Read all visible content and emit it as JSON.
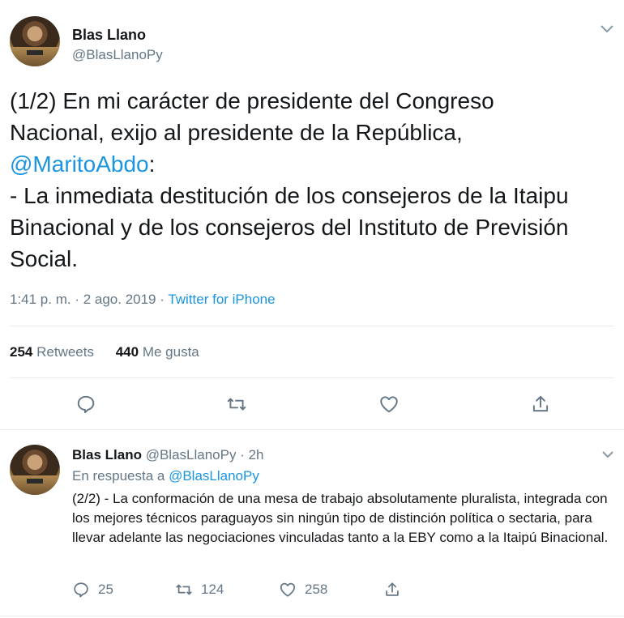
{
  "main_tweet": {
    "author_name": "Blas Llano",
    "author_handle": "@BlasLlanoPy",
    "text_before_mention": "(1/2) En mi carácter de presidente del Congreso\nNacional, exijo al presidente de la República,\n",
    "mention": "@MaritoAbdo",
    "text_after_mention": ":\n- La inmediata destitución de los consejeros de la Itaipu\nBinacional y de los consejeros del Instituto de Previsión\nSocial.",
    "timestamp": "1:41 p. m. · 2 ago. 2019 · ",
    "source": "Twitter for iPhone",
    "retweets_count": "254",
    "retweets_label": "Retweets",
    "likes_count": "440",
    "likes_label": "Me gusta",
    "icons": [
      "reply-icon",
      "retweet-icon",
      "like-icon",
      "share-icon"
    ]
  },
  "reply_tweet": {
    "author_name": "Blas Llano",
    "author_handle": "@BlasLlanoPy · 2h",
    "reply_prefix": "En respuesta a ",
    "reply_to": "@BlasLlanoPy",
    "text": "(2/2) - La conformación de una mesa de trabajo absolutamente pluralista, integrada con los mejores técnicos paraguayos sin ningún tipo de distinción política o sectaria, para llevar adelante las negociaciones vinculadas tanto a la EBY como a la Itaipú Binacional.",
    "reply_count": "25",
    "retweet_count": "124",
    "like_count": "258"
  },
  "colors": {
    "text": "#14171a",
    "secondary": "#657786",
    "link": "#1b95e0",
    "divider": "#e6ecf0"
  }
}
